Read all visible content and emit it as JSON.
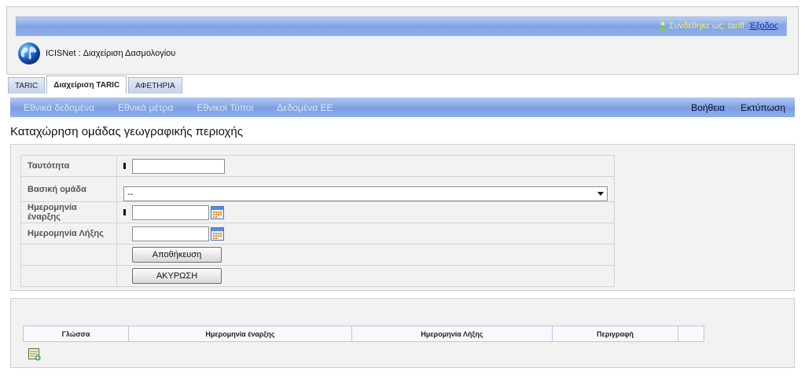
{
  "header": {
    "user_label": "Συνδέθηκε ως:",
    "user_name": "tariff",
    "logout": "Έξοδος",
    "app_title": "ICISNet : Διαχείριση Δασμολογίου"
  },
  "tabs": [
    {
      "label": "TARIC",
      "active": false
    },
    {
      "label": "Διαχείριση TARIC",
      "active": true
    },
    {
      "label": "ΑΦΕΤΗΡΙΑ",
      "active": false
    }
  ],
  "subnav": {
    "items": [
      "Εθνικά δεδομένα",
      "Εθνικά μέτρα",
      "Εθνικοί Τύποι",
      "Δεδομένα ΕΕ"
    ],
    "right": [
      "Βοήθεια",
      "Εκτύπωση"
    ]
  },
  "page_title": "Καταχώρηση ομάδας γεωγραφικής περιοχής",
  "form": {
    "id_label": "Ταυτότητα",
    "id_value": "",
    "base_group_label": "Βασική ομάδα",
    "base_group_value": "--",
    "start_date_label": "Ημερομηνία έναρξης",
    "start_date_value": "",
    "end_date_label": "Ημερομηνία Λήξης",
    "end_date_value": "",
    "save_button": "Αποθήκευση",
    "cancel_button": "ΑΚΥΡΩΣΗ"
  },
  "descriptions_table": {
    "headers": [
      "Γλώσσα",
      "Ημερομηνία έναρξης",
      "Ημερομηνία Λήξης",
      "Περιγραφή",
      ""
    ]
  },
  "icons": {
    "user": "user-icon",
    "globe": "globe-logo",
    "calendar": "calendar-icon",
    "dropdown": "chevron-down-icon",
    "add_row": "add-row-icon"
  }
}
